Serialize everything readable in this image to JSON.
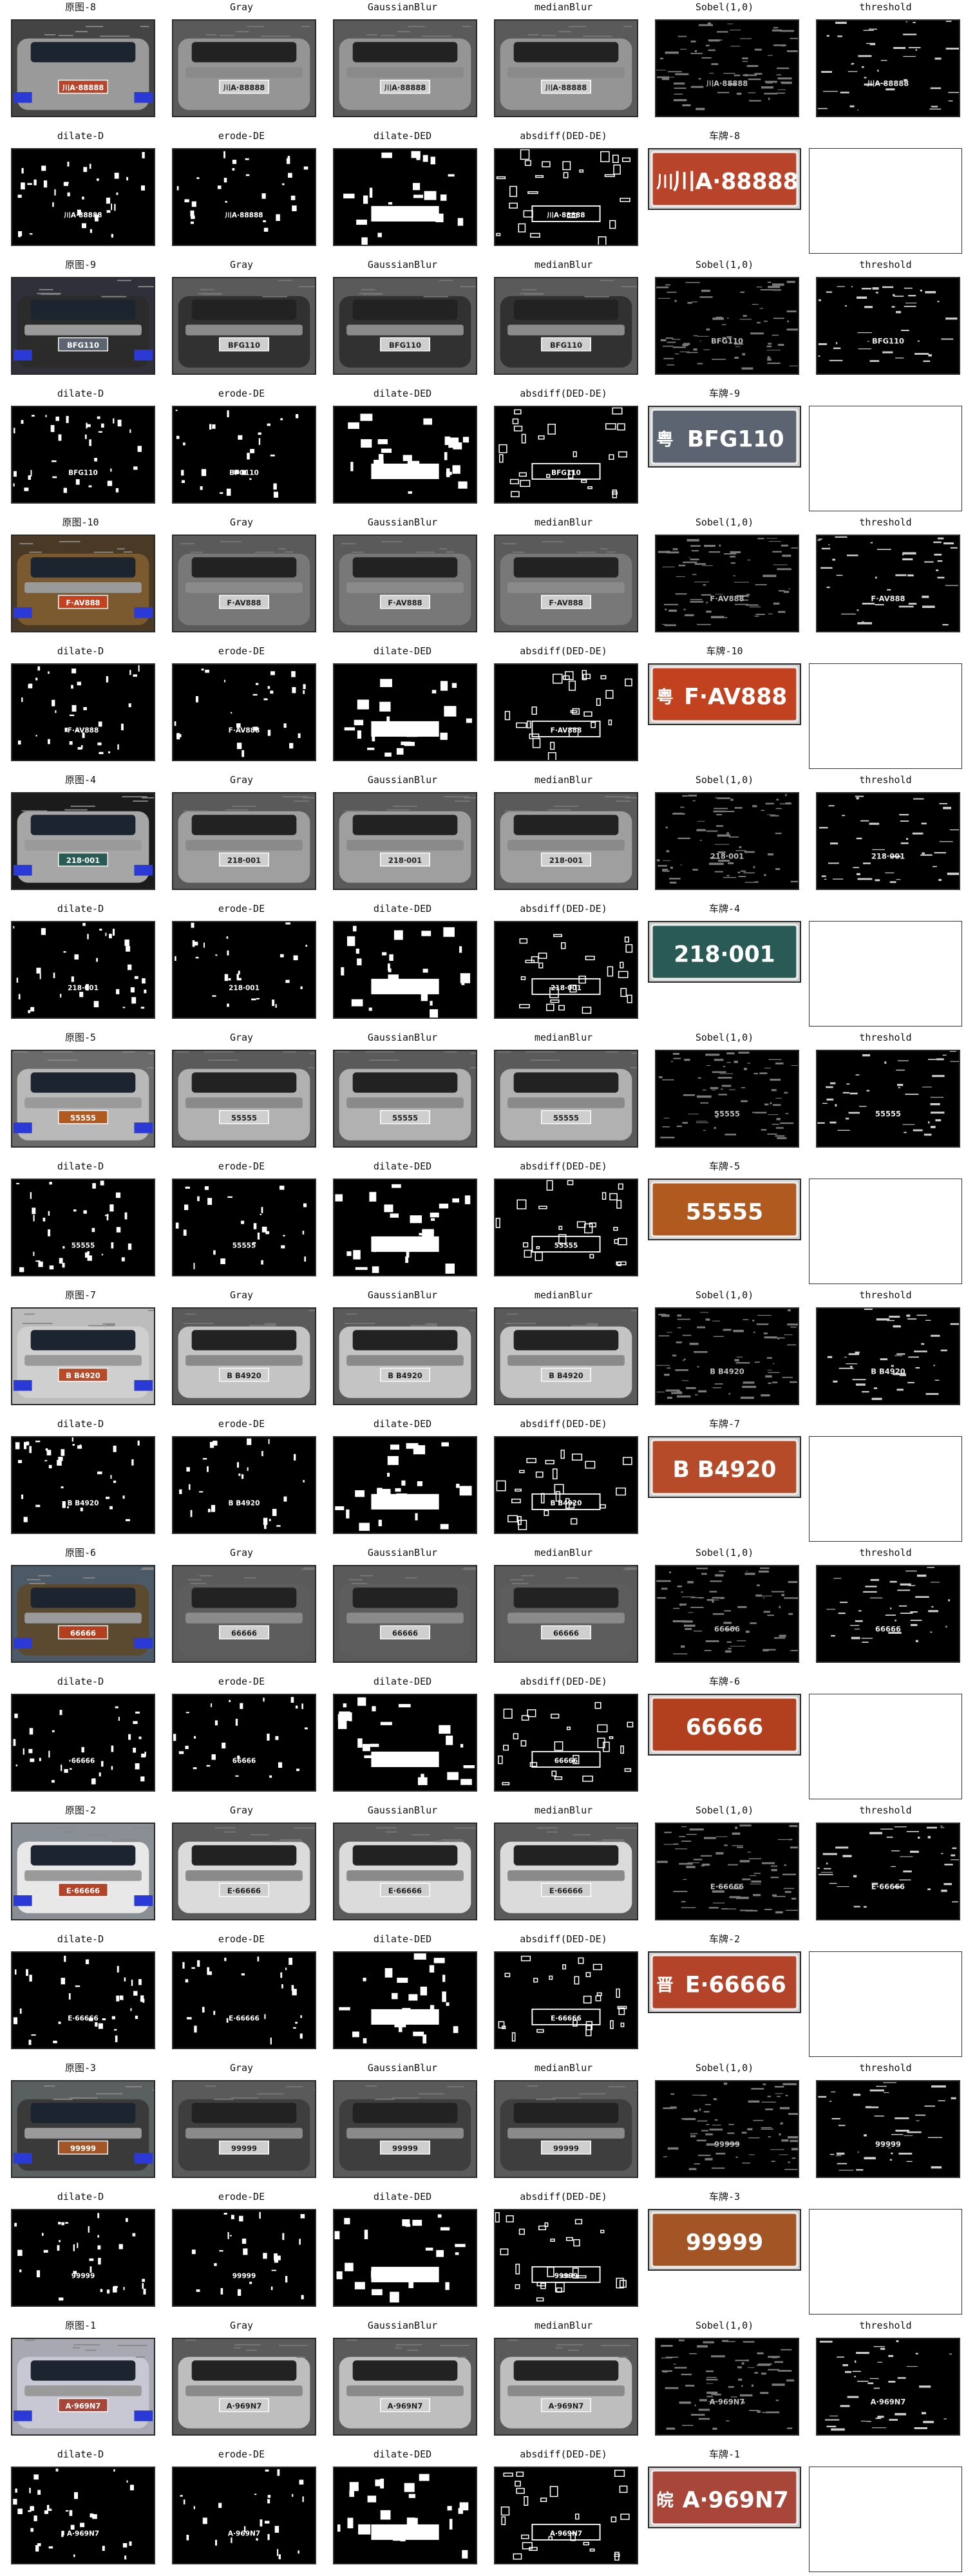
{
  "columns": 6,
  "groups": [
    {
      "original": "原图-8",
      "plate_title": "车牌-8",
      "plate_text": "川A·88888",
      "plate_color": "#b8452a",
      "plate_prefix": "川"
    },
    {
      "original": "原图-9",
      "plate_title": "车牌-9",
      "plate_text": "BFG110",
      "plate_color": "#5b6470",
      "plate_prefix": "粤"
    },
    {
      "original": "原图-10",
      "plate_title": "车牌-10",
      "plate_text": "F·AV888",
      "plate_color": "#c2411f",
      "plate_prefix": "粤"
    },
    {
      "original": "原图-4",
      "plate_title": "车牌-4",
      "plate_text": "218·001",
      "plate_color": "#2a5a56",
      "plate_prefix": ""
    },
    {
      "original": "原图-5",
      "plate_title": "车牌-5",
      "plate_text": "55555",
      "plate_color": "#b15a1f",
      "plate_prefix": ""
    },
    {
      "original": "原图-7",
      "plate_title": "车牌-7",
      "plate_text": "B B4920",
      "plate_color": "#b64b2a",
      "plate_prefix": ""
    },
    {
      "original": "原图-6",
      "plate_title": "车牌-6",
      "plate_text": "66666",
      "plate_color": "#b2401e",
      "plate_prefix": ""
    },
    {
      "original": "原图-2",
      "plate_title": "车牌-2",
      "plate_text": "E·66666",
      "plate_color": "#b3442a",
      "plate_prefix": "晋"
    },
    {
      "original": "原图-3",
      "plate_title": "车牌-3",
      "plate_text": "99999",
      "plate_color": "#a45525",
      "plate_prefix": ""
    },
    {
      "original": "原图-1",
      "plate_title": "车牌-1",
      "plate_text": "A·969N7",
      "plate_color": "#a9463a",
      "plate_prefix": "皖"
    }
  ],
  "row1_titles": [
    "Gray",
    "GaussianBlur",
    "medianBlur",
    "Sobel(1,0)",
    "threshold"
  ],
  "row2_titles": [
    "dilate-D",
    "erode-DE",
    "dilate-DED",
    "absdiff(DED-DE)"
  ]
}
